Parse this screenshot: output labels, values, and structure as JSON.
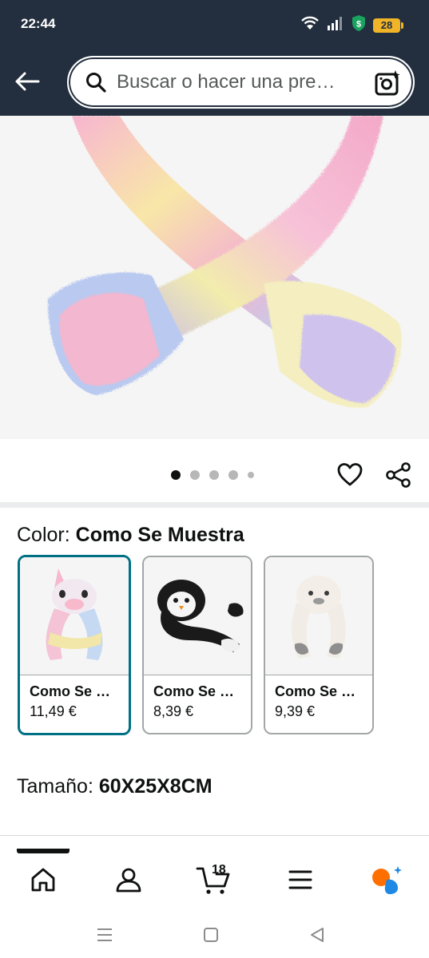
{
  "status_bar": {
    "time": "22:44",
    "battery": "28",
    "icons": [
      "wifi-icon",
      "signal-icon",
      "security-shield-icon",
      "battery-icon"
    ]
  },
  "header": {
    "search_placeholder": "Buscar o hacer una pre…",
    "icons": [
      "back-arrow-icon",
      "search-icon",
      "camera-lens-icon"
    ]
  },
  "carousel": {
    "dot_count": 5,
    "active_index": 0
  },
  "color": {
    "label": "Color:",
    "value": "Como Se Muestra"
  },
  "variants": [
    {
      "name": "Como Se …",
      "price": "11,49 €",
      "selected": true,
      "icon": "unicorn-plush-hat-thumbnail"
    },
    {
      "name": "Como Se …",
      "price": "8,39 €",
      "selected": false,
      "icon": "penguin-plush-hat-thumbnail"
    },
    {
      "name": "Como Se …",
      "price": "9,39 €",
      "selected": false,
      "icon": "seal-plush-hat-thumbnail"
    }
  ],
  "size": {
    "label": "Tamaño:",
    "value": "60X25X8CM"
  },
  "bottom_nav": {
    "cart_count": "18",
    "items": [
      "home-icon",
      "account-icon",
      "cart-icon",
      "menu-icon",
      "rufus-assistant-icon"
    ]
  },
  "colors": {
    "header_bg": "#232f3e",
    "accent_selected": "#007185",
    "text": "#0f1111",
    "battery": "#f0b429",
    "shield": "#1aa260",
    "assistant_orange": "#ff6f00",
    "assistant_blue": "#1e88e5"
  }
}
